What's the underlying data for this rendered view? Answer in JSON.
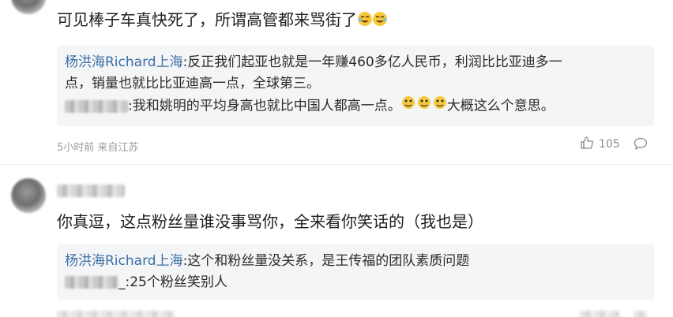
{
  "comment1": {
    "text": "可见棒子车真快死了，所谓高管都来骂街了",
    "replies": [
      {
        "author": "杨洪海Richard上海",
        "text": ":反正我们起亚也就是一年赚460多亿人民币，利润比比亚迪多一",
        "cont": "点，销量也就比比亚迪高一点，全球第三。"
      },
      {
        "author": "",
        "text": ":我和姚明的平均身高也就比中国人都高一点。",
        "suffix": "大概这么个意思。"
      }
    ],
    "meta": "5小时前 来自江苏",
    "likes": "105"
  },
  "comment2": {
    "text": "你真逗，这点粉丝量谁没事骂你，全来看你笑话的（我也是）",
    "replies": [
      {
        "author": "杨洪海Richard上海",
        "text": ":这个和粉丝量没关系，是王传福的团队素质问题"
      },
      {
        "author": "",
        "text": "_:25个粉丝笑别人"
      }
    ]
  },
  "icons": {
    "like": "thumbs-up-icon",
    "comment": "comment-bubble-icon",
    "emoji": "laughing-crying-emoji",
    "emoji2": "smirk-face-emoji"
  },
  "colors": {
    "author": "#3b6ea5",
    "reply_bg": "#f4f5f7",
    "meta": "#9a9a9a"
  }
}
